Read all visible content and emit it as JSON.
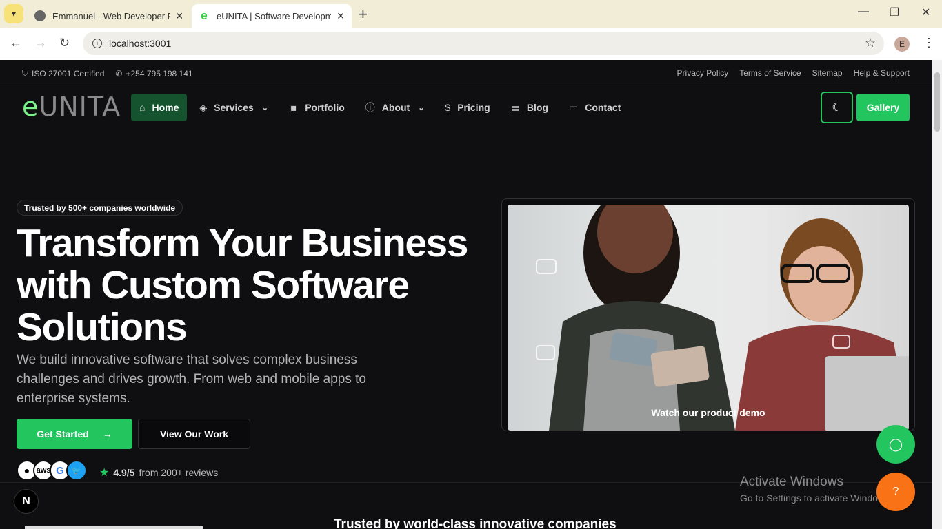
{
  "browser": {
    "tabs": [
      {
        "title": "Emmanuel - Web Developer Portfolio"
      },
      {
        "title": "eUNITA | Software Development"
      }
    ],
    "url": "localhost:3001",
    "profile_initial": "E"
  },
  "topbar": {
    "certified": "ISO 27001 Certified",
    "phone": "+254 795 198 141",
    "links": [
      "Privacy Policy",
      "Terms of Service",
      "Sitemap",
      "Help & Support"
    ]
  },
  "logo": {
    "first": "e",
    "rest": "UNITA"
  },
  "nav": {
    "items": [
      {
        "label": "Home",
        "icon": "home-icon"
      },
      {
        "label": "Services",
        "icon": "layers-icon"
      },
      {
        "label": "Portfolio",
        "icon": "briefcase-icon"
      },
      {
        "label": "About",
        "icon": "info-icon"
      },
      {
        "label": "Pricing",
        "icon": "dollar-icon"
      },
      {
        "label": "Blog",
        "icon": "file-icon"
      },
      {
        "label": "Contact",
        "icon": "message-icon"
      }
    ],
    "gallery": "Gallery"
  },
  "hero": {
    "badge": "Trusted by 500+ companies worldwide",
    "headline": "Transform Your Business with Custom Software Solutions",
    "sub": "We build innovative software that solves complex business challenges and drives growth. From web and mobile apps to enterprise systems.",
    "cta_primary": "Get Started",
    "cta_secondary": "View Our Work",
    "rating": "4.9/5",
    "rating_suffix": "from 200+ reviews",
    "video_caption": "Watch our product demo",
    "client_logos": [
      "",
      "aws",
      "G",
      ""
    ]
  },
  "trusted_heading": "Trusted by world-class innovative companies",
  "windows_watermark": {
    "line1": "Activate Windows",
    "line2": "Go to Settings to activate Windows."
  },
  "colors": {
    "accent": "#22c55e",
    "orange": "#f97316",
    "bg": "#0f0f12"
  }
}
